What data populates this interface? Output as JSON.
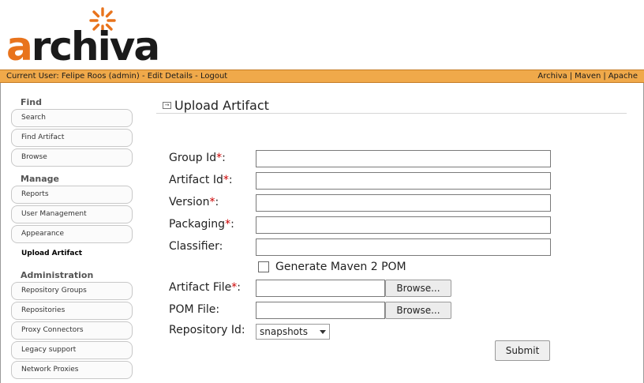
{
  "logo": {
    "first_letter": "a",
    "rest": "rchiva"
  },
  "userbar": {
    "current_user_label": "Current User:",
    "user_name": "Felipe Roos (admin)",
    "separator": "-",
    "edit_details": "Edit Details",
    "logout": "Logout",
    "right_links": [
      "Archiva",
      "Maven",
      "Apache"
    ],
    "right_separator": "|"
  },
  "sidebar": {
    "sections": [
      {
        "title": "Find",
        "items": [
          "Search",
          "Find Artifact",
          "Browse"
        ]
      },
      {
        "title": "Manage",
        "items": [
          "Reports",
          "User Management",
          "Appearance",
          "Upload Artifact"
        ]
      },
      {
        "title": "Administration",
        "items": [
          "Repository Groups",
          "Repositories",
          "Proxy Connectors",
          "Legacy support",
          "Network Proxies"
        ]
      }
    ],
    "active_item": "Upload Artifact"
  },
  "main": {
    "title": "Upload Artifact",
    "form": {
      "group_id_label": "Group Id",
      "artifact_id_label": "Artifact Id",
      "version_label": "Version",
      "packaging_label": "Packaging",
      "classifier_label": "Classifier:",
      "required_mark": "*",
      "colon": ":",
      "generate_pom_label": "Generate Maven 2 POM",
      "artifact_file_label": "Artifact File",
      "pom_file_label": "POM File:",
      "browse_label": "Browse...",
      "repository_id_label": "Repository Id:",
      "repository_id_value": "snapshots",
      "submit_label": "Submit",
      "group_id_value": "",
      "artifact_id_value": "",
      "version_value": "",
      "packaging_value": "",
      "classifier_value": ""
    }
  },
  "colors": {
    "accent": "#f0a94a",
    "logo_orange": "#e8731c",
    "required": "#cc0000"
  }
}
